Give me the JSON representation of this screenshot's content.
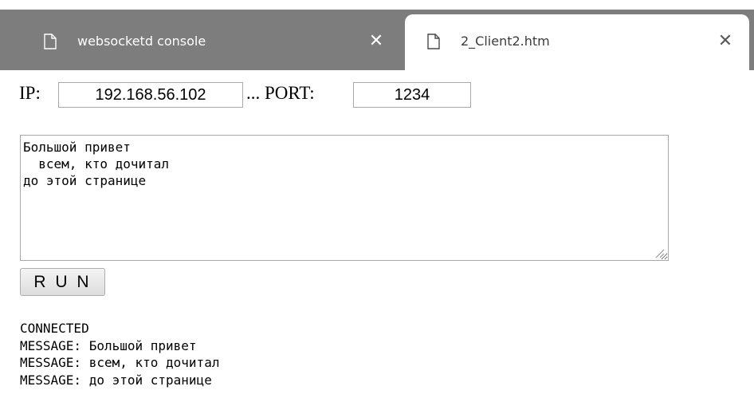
{
  "tabs": [
    {
      "title": "websocketd console",
      "icon": "file-icon",
      "active": false
    },
    {
      "title": "2_Client2.htm",
      "icon": "file-icon",
      "active": true
    }
  ],
  "form": {
    "ip_label": "IP:",
    "ip_value": "192.168.56.102",
    "separator_label": "... PORT:",
    "port_value": "1234",
    "message_text": "Большой привет\n  всем, кто дочитал\nдо этой странице",
    "run_label": "R U N"
  },
  "log": [
    "CONNECTED",
    "MESSAGE: Большой привет",
    "MESSAGE: всем, кто дочитал",
    "MESSAGE: до этой странице"
  ],
  "colors": {
    "tabstrip": "#7d7d7d",
    "active_tab": "#ffffff"
  }
}
